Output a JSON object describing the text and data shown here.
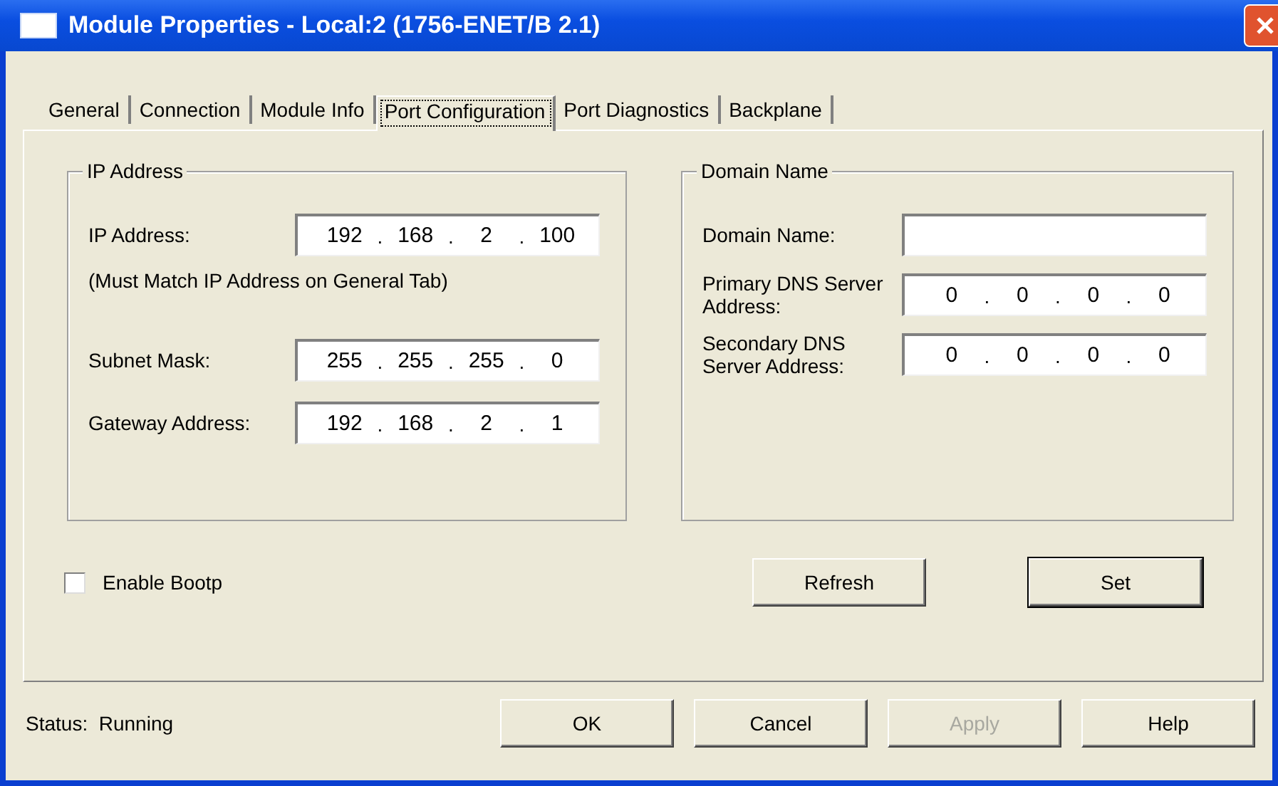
{
  "window": {
    "title": "Module Properties - Local:2 (1756-ENET/B 2.1)"
  },
  "tabs": [
    {
      "label": "General",
      "selected": false
    },
    {
      "label": "Connection",
      "selected": false
    },
    {
      "label": "Module Info",
      "selected": false
    },
    {
      "label": "Port Configuration",
      "selected": true
    },
    {
      "label": "Port Diagnostics",
      "selected": false
    },
    {
      "label": "Backplane",
      "selected": false
    }
  ],
  "ip_group": {
    "title": "IP Address",
    "rows": [
      {
        "kind": "ip",
        "label": "IP Address:",
        "octets": [
          "192",
          "168",
          "2",
          "100"
        ],
        "separator": "."
      },
      {
        "kind": "note",
        "text": "(Must Match IP Address on General Tab)"
      },
      {
        "kind": "ip",
        "label": "Subnet Mask:",
        "octets": [
          "255",
          "255",
          "255",
          "0"
        ],
        "separator": "."
      },
      {
        "kind": "ip",
        "label": "Gateway Address:",
        "octets": [
          "192",
          "168",
          "2",
          "1"
        ],
        "separator": "."
      }
    ]
  },
  "domain_group": {
    "title": "Domain Name",
    "rows": [
      {
        "kind": "text",
        "label": "Domain Name:"
      },
      {
        "kind": "ip",
        "label": "Primary DNS Server Address:",
        "octets": [
          "0",
          "0",
          "0",
          "0"
        ],
        "separator": "."
      },
      {
        "kind": "ip",
        "label": "Secondary DNS Server Address:",
        "octets": [
          "0",
          "0",
          "0",
          "0"
        ],
        "separator": "."
      }
    ]
  },
  "enable_bootp": {
    "label": "Enable Bootp",
    "checked": false
  },
  "panel_buttons": [
    {
      "label": "Refresh",
      "default": false
    },
    {
      "label": "Set",
      "default": true
    }
  ],
  "status": {
    "label": "Status:",
    "value": "Running"
  },
  "dialog_buttons": [
    {
      "label": "OK",
      "disabled": false
    },
    {
      "label": "Cancel",
      "disabled": false
    },
    {
      "label": "Apply",
      "disabled": true
    },
    {
      "label": "Help",
      "disabled": false
    }
  ]
}
